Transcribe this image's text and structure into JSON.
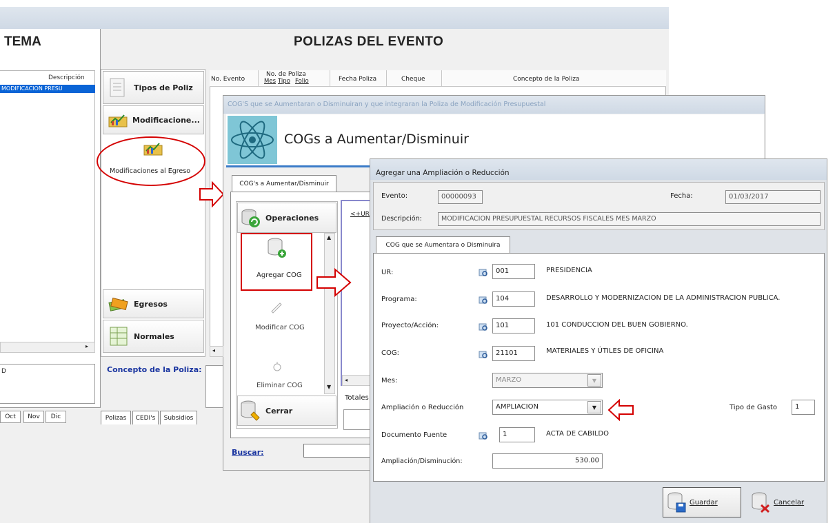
{
  "bg": {
    "sistema_title": "TEMA",
    "descripcion_header": "Descripción",
    "selected_row": "MODIFICACION PRESU",
    "concept_left": "D",
    "months": [
      "Oct",
      "Nov",
      "Dic"
    ]
  },
  "polizas_window": {
    "title": "POLIZAS DEL EVENTO",
    "nav": {
      "tipos": "Tipos de Poliz",
      "modificaciones": "Modificacione...",
      "modif_egreso": "Modificaciones al Egreso",
      "egresos": "Egresos",
      "normales": "Normales"
    },
    "table_headers": {
      "no_evento": "No. Evento",
      "no_poliza": "No. de Poliza",
      "mes": "Mes",
      "tipo": "Tipo",
      "folio": "Folio",
      "fecha": "Fecha Poliza",
      "cheque": "Cheque",
      "concepto": "Concepto de la Poliza"
    },
    "concepto_label": "Concepto de la Poliza:",
    "bottom_tabs": [
      "Polizas",
      "CEDI's",
      "Subsidios"
    ]
  },
  "cogs_window": {
    "title": "COG'S que se Aumentaran o Disminuiran y que integraran la Poliza de Modificación Presupuestal",
    "banner": "COGs a Aumentar/Disminuir",
    "tab": "COG's a Aumentar/Disminuir",
    "operaciones": "Operaciones",
    "agregar": "Agregar COG",
    "modificar": "Modificar COG",
    "eliminar": "Eliminar COG",
    "cerrar": "Cerrar",
    "grid_header": "<+UR",
    "totales": "Totales",
    "buscar_label": "Buscar:"
  },
  "dialog": {
    "title": "Agregar una Ampliación o Reducción",
    "evento_label": "Evento:",
    "evento_value": "00000093",
    "fecha_label": "Fecha:",
    "fecha_value": "01/03/2017",
    "descripcion_label": "Descripción:",
    "descripcion_value": "MODIFICACION PRESUPUESTAL RECURSOS FISCALES MES MARZO",
    "tab": "COG que se Aumentara o Disminuira",
    "ur_label": "UR:",
    "ur_value": "001",
    "ur_desc": "PRESIDENCIA",
    "programa_label": "Programa:",
    "programa_value": "104",
    "programa_desc": "DESARROLLO Y MODERNIZACION DE LA ADMINISTRACION PUBLICA.",
    "proyecto_label": "Proyecto/Acción:",
    "proyecto_value": "101",
    "proyecto_desc": "101 CONDUCCION DEL BUEN GOBIERNO.",
    "cog_label": "COG:",
    "cog_value": "21101",
    "cog_desc": "MATERIALES Y ÚTILES DE OFICINA",
    "mes_label": "Mes:",
    "mes_value": "MARZO",
    "ampred_label": "Ampliación o Reducción",
    "ampred_value": "AMPLIACION",
    "tipo_gasto_label": "Tipo de Gasto",
    "tipo_gasto_value": "1",
    "doc_fuente_label": "Documento Fuente",
    "doc_fuente_value": "1",
    "doc_fuente_desc": "ACTA DE CABILDO",
    "ampdis_label": "Ampliación/Disminución:",
    "ampdis_value": "530.00",
    "guardar_label": "Guardar",
    "cancelar_label": "Cancelar"
  },
  "colors": {
    "highlight_red": "#d40000",
    "selection_blue": "#0a64d6",
    "window_bg": "#f0f0f0"
  }
}
